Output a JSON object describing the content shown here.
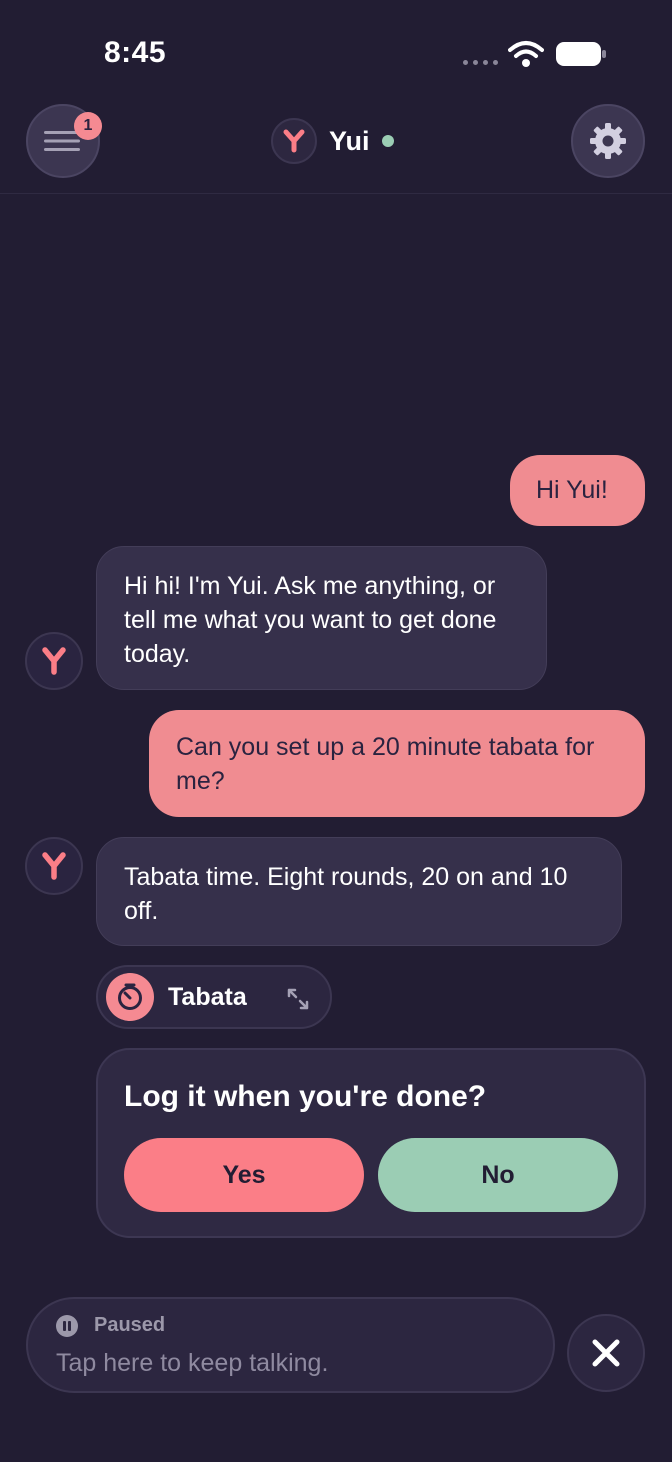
{
  "status_bar": {
    "time": "8:45"
  },
  "header": {
    "menu_badge": "1",
    "assistant_name": "Yui"
  },
  "messages": [
    {
      "role": "user",
      "text": "Hi Yui!"
    },
    {
      "role": "assistant",
      "text": "Hi hi! I'm Yui. Ask me anything, or tell me what you want to get done today."
    },
    {
      "role": "user",
      "text": "Can you set up a 20 minute tabata for me?"
    },
    {
      "role": "assistant",
      "text": "Tabata time. Eight rounds, 20 on and 10 off."
    }
  ],
  "timer_chip": {
    "label": "Tabata"
  },
  "prompt_card": {
    "question": "Log it when you're done?",
    "yes_label": "Yes",
    "no_label": "No"
  },
  "input_bar": {
    "status": "Paused",
    "hint": "Tap here to keep talking."
  },
  "colors": {
    "background": "#221d33",
    "accent_pink": "#fb7e87",
    "accent_green": "#9bcdb4",
    "bubble_bot": "#36304b"
  }
}
